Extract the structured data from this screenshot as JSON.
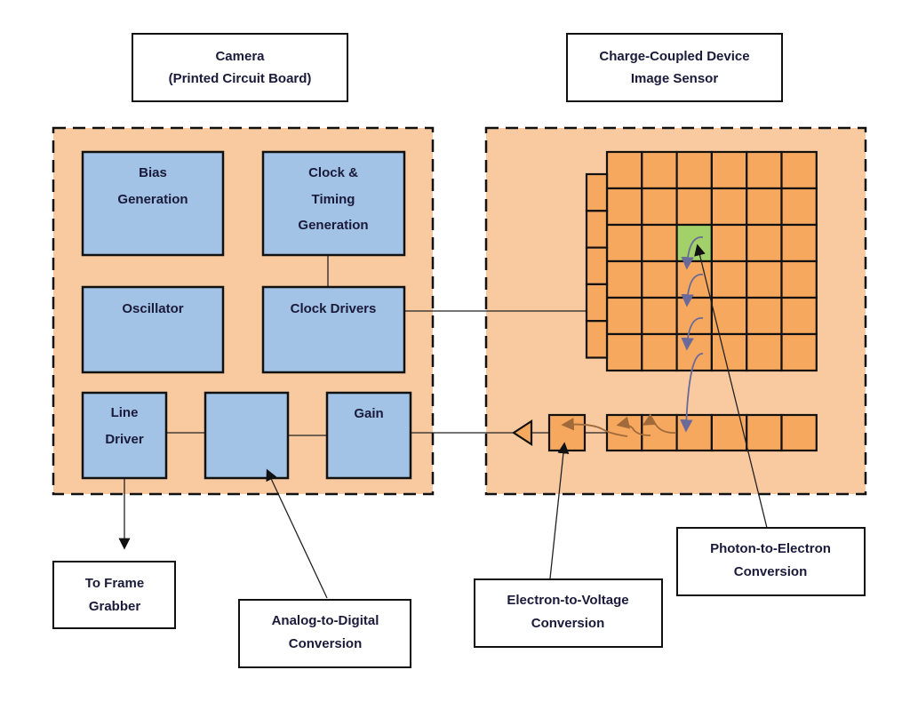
{
  "title_boxes": {
    "camera": [
      "Camera",
      "(Printed Circuit Board)"
    ],
    "ccd": [
      "Charge-Coupled Device",
      "Image Sensor"
    ]
  },
  "camera_blocks": {
    "bias": [
      "Bias",
      "Generation"
    ],
    "clock_timing": [
      "Clock &",
      "Timing",
      "Generation"
    ],
    "oscillator": [
      "Oscillator"
    ],
    "clock_drivers": [
      "Clock Drivers"
    ],
    "line_driver": [
      "Line",
      "Driver"
    ],
    "adc": [],
    "gain": [
      "Gain"
    ]
  },
  "callouts": {
    "frame_grabber": [
      "To Frame",
      "Grabber"
    ],
    "adc": [
      "Analog-to-Digital",
      "Conversion"
    ],
    "e_to_v": [
      "Electron-to-Voltage",
      "Conversion"
    ],
    "p_to_e": [
      "Photon-to-Electron",
      "Conversion"
    ]
  },
  "sensor": {
    "rows": 6,
    "cols": 6,
    "highlighted_cell": {
      "row": 3,
      "col": 3
    },
    "serial_register_cells": 6,
    "vertical_driver_cells": 5
  },
  "colors": {
    "panel": "#f9caa0",
    "block": "#a2c2e6",
    "pixel": "#f7a85f",
    "highlight": "#a2d16a"
  }
}
